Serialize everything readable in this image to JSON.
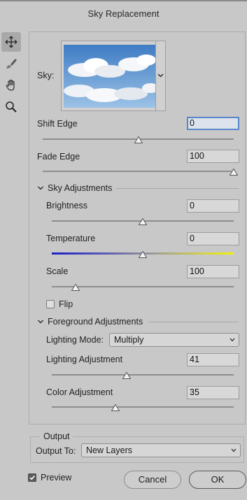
{
  "window": {
    "title": "Sky Replacement"
  },
  "tools": [
    {
      "name": "move-tool",
      "icon": "move-arrows-icon",
      "active": true
    },
    {
      "name": "sky-brush-tool",
      "icon": "brush-icon",
      "active": false
    },
    {
      "name": "hand-tool",
      "icon": "hand-icon",
      "active": false
    },
    {
      "name": "zoom-tool",
      "icon": "magnifier-icon",
      "active": false
    }
  ],
  "sky": {
    "label": "Sky:",
    "preview_icon": "sky-clouds-thumbnail",
    "dropdown_icon": "chevron-down-icon"
  },
  "shift_edge": {
    "label": "Shift Edge",
    "value": "0",
    "level": 0.5
  },
  "fade_edge": {
    "label": "Fade Edge",
    "value": "100",
    "level": 1.0
  },
  "sky_adjustments": {
    "header": "Sky Adjustments",
    "brightness": {
      "label": "Brightness",
      "value": "0",
      "level": 0.5
    },
    "temperature": {
      "label": "Temperature",
      "value": "0",
      "level": 0.5
    },
    "scale": {
      "label": "Scale",
      "value": "100",
      "level": 0.13
    },
    "flip": {
      "label": "Flip",
      "checked": false
    }
  },
  "foreground_adjustments": {
    "header": "Foreground Adjustments",
    "lighting_mode": {
      "label": "Lighting Mode:",
      "value": "Multiply"
    },
    "lighting_adjustment": {
      "label": "Lighting Adjustment",
      "value": "41",
      "level": 0.41
    },
    "color_adjustment": {
      "label": "Color Adjustment",
      "value": "35",
      "level": 0.35
    }
  },
  "output": {
    "header": "Output",
    "output_to": {
      "label": "Output To:",
      "value": "New Layers"
    }
  },
  "preview": {
    "label": "Preview",
    "checked": true
  },
  "buttons": {
    "cancel": "Cancel",
    "ok": "OK"
  },
  "colors": {
    "focus_ring": "#5a86c8",
    "background": "#c8c8c8"
  }
}
